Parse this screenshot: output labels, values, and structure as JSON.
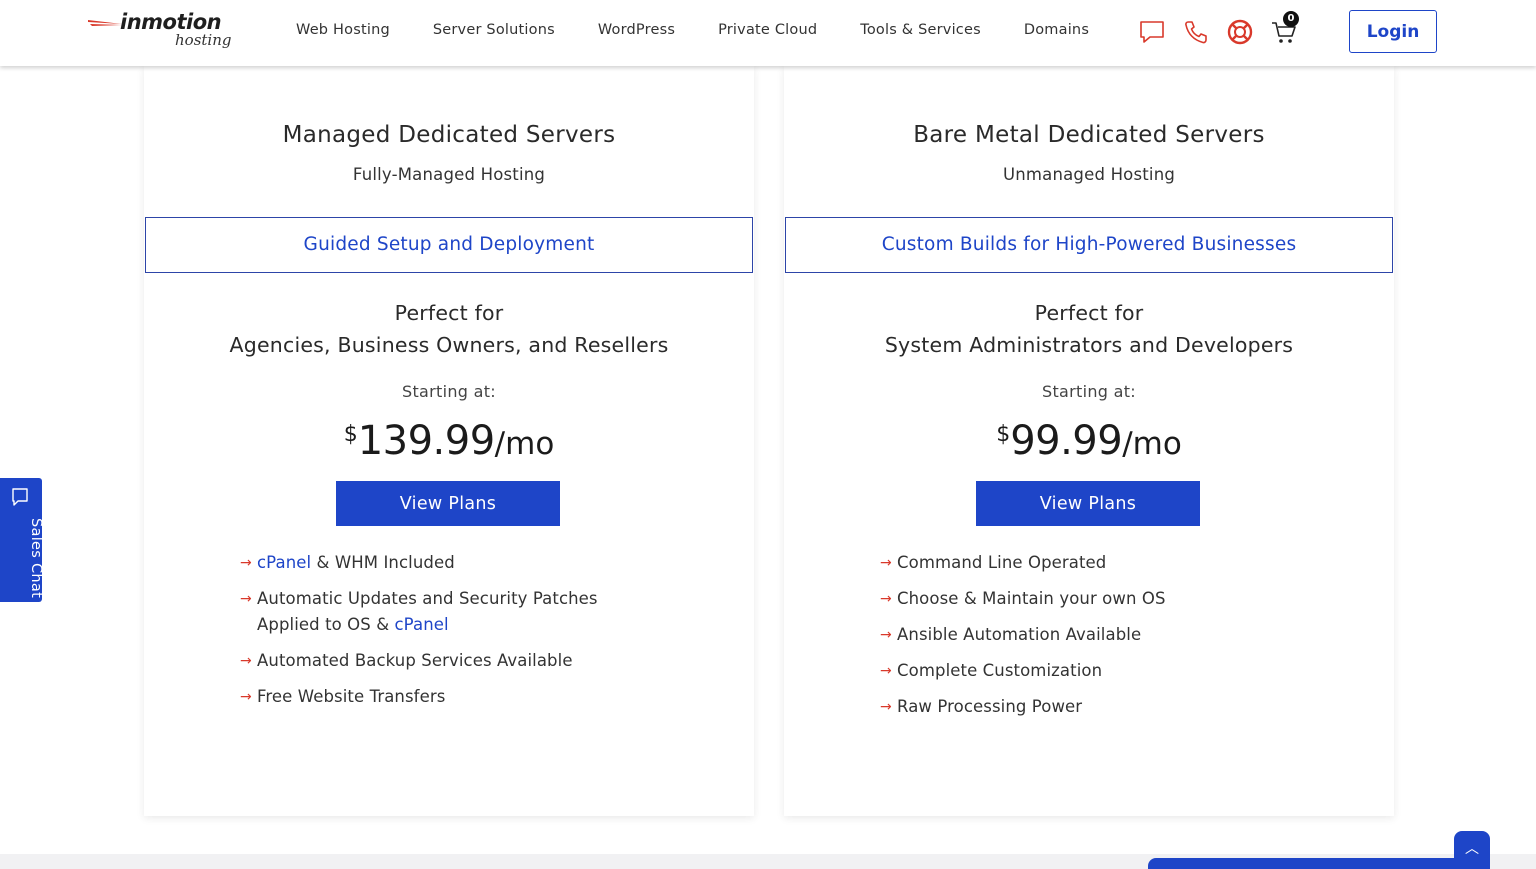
{
  "header": {
    "logo_main": "inmotion",
    "logo_sub": "hosting",
    "nav": [
      "Web Hosting",
      "Server Solutions",
      "WordPress",
      "Private Cloud",
      "Tools & Services",
      "Domains"
    ],
    "icons": [
      "chat-icon",
      "phone-icon",
      "support-icon",
      "cart-icon"
    ],
    "cart_count": "0",
    "login_label": "Login"
  },
  "cards": [
    {
      "title": "Managed Dedicated Servers",
      "subtitle": "Fully-Managed Hosting",
      "banner": "Guided Setup and Deployment",
      "perfect_for_label": "Perfect for",
      "perfect_for": "Agencies, Business Owners, and Resellers",
      "starting_label": "Starting at:",
      "currency": "$",
      "price": "139.99",
      "per": "/mo",
      "button": "View Plans",
      "features": [
        {
          "link": "cPanel",
          "text": " & WHM Included"
        },
        {
          "line1": "Automatic Updates and Security Patches",
          "line2_text": "Applied to OS & ",
          "line2_link": "cPanel"
        },
        {
          "text": "Automated Backup Services Available"
        },
        {
          "text": "Free Website Transfers"
        }
      ]
    },
    {
      "title": "Bare Metal Dedicated Servers",
      "subtitle": "Unmanaged Hosting",
      "banner": "Custom Builds for High-Powered Businesses",
      "perfect_for_label": "Perfect for",
      "perfect_for": "System Administrators and Developers",
      "starting_label": "Starting at:",
      "currency": "$",
      "price": "99.99",
      "per": "/mo",
      "button": "View Plans",
      "features": [
        {
          "text": "Command Line Operated"
        },
        {
          "text": "Choose & Maintain your own OS"
        },
        {
          "text": "Ansible Automation Available"
        },
        {
          "text": "Complete Customization"
        },
        {
          "text": "Raw Processing Power"
        }
      ]
    }
  ],
  "sales_chat": {
    "label": "Sales Chat"
  },
  "colors": {
    "accent": "#1e45c8",
    "arrow": "#d9392b",
    "icon_red": "#d9392b"
  }
}
